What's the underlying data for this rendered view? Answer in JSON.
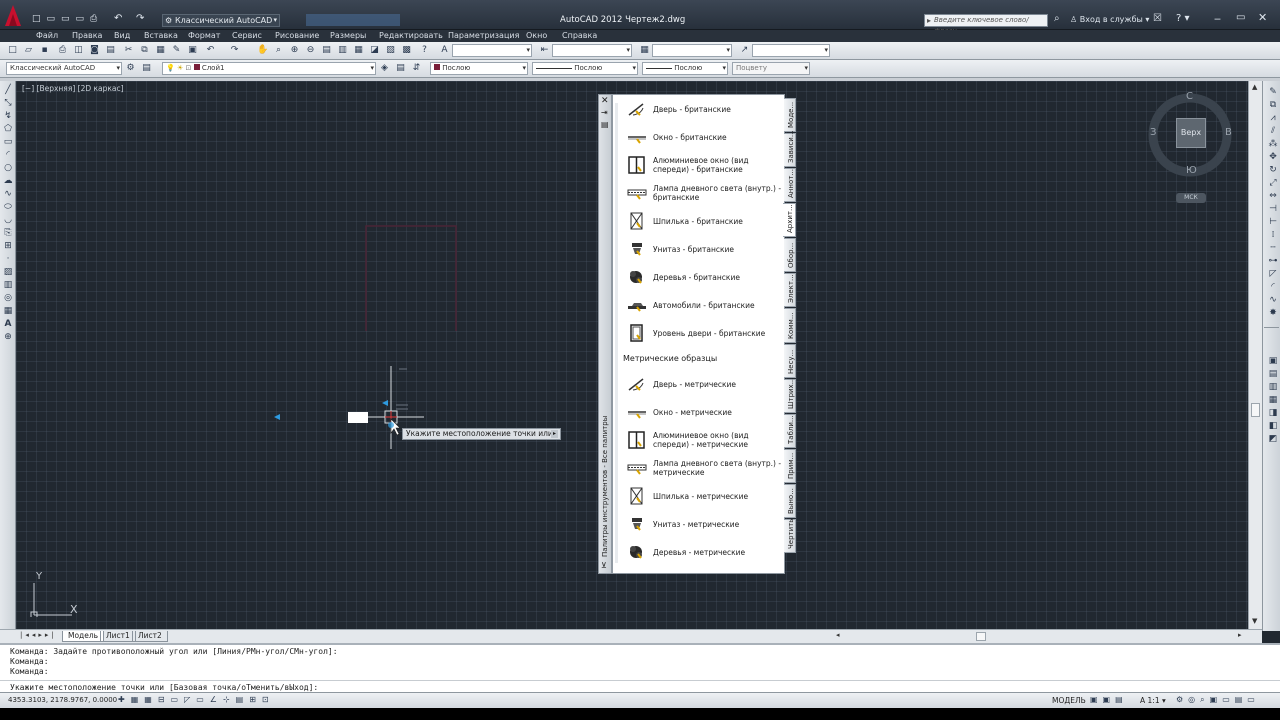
{
  "titlebar": {
    "workspace": "Классический AutoCAD",
    "title": "AutoCAD 2012   Чертеж2.dwg",
    "search_placeholder": "Введите ключевое слово/фразу",
    "signin": "Вход в службы"
  },
  "menu": [
    "Файл",
    "Правка",
    "Вид",
    "Вставка",
    "Формат",
    "Сервис",
    "Рисование",
    "Размеры",
    "Редактировать",
    "Параметризация",
    "Окно",
    "Справка"
  ],
  "toolbar2": {
    "workspace": "Классический AutoCAD",
    "layer": "Слой1",
    "color": "Послою",
    "linetype": "Послою",
    "lineweight": "Послою",
    "plotstyle": "Поцвету"
  },
  "viewport": {
    "label": "[−] [Верхняя] [2D каркас]",
    "tooltip": "Укажите местоположение точки или"
  },
  "viewcube": {
    "top": "Верх",
    "north": "С",
    "south": "Ю",
    "west": "З",
    "east": "В",
    "wcs": "МСК"
  },
  "ucs": {
    "y": "Y",
    "x": "X"
  },
  "palette": {
    "strip_title": "Палитры инструментов - Все палитры",
    "tabs": [
      "Моде...",
      "Зависи...",
      "Аннот...",
      "Архит...",
      "Обор...",
      "Элект...",
      "Комм...",
      "Несу...",
      "Штрих...",
      "Табли...",
      "Прим...",
      "Выно...",
      "Чертить"
    ],
    "items_british": [
      {
        "label": "Дверь - британские",
        "icon": "door-icon"
      },
      {
        "label": "Окно - британские",
        "icon": "window-icon"
      },
      {
        "label": "Алюминиевое окно (вид спереди) - британские",
        "icon": "aluminum-window-icon"
      },
      {
        "label": "Лампа дневного света (внутр.) - британские",
        "icon": "fluorescent-lamp-icon"
      },
      {
        "label": "Шпилька - британские",
        "icon": "stud-icon"
      },
      {
        "label": "Унитаз - британские",
        "icon": "toilet-icon"
      },
      {
        "label": "Деревья - британские",
        "icon": "tree-icon"
      },
      {
        "label": "Автомобили - британские",
        "icon": "car-icon"
      },
      {
        "label": "Уровень двери - британские",
        "icon": "door-elevation-icon"
      }
    ],
    "metric_header": "Метрические образцы",
    "items_metric": [
      {
        "label": "Дверь - метрические",
        "icon": "door-icon"
      },
      {
        "label": "Окно - метрические",
        "icon": "window-icon"
      },
      {
        "label": "Алюминиевое окно (вид спереди) - метрические",
        "icon": "aluminum-window-icon"
      },
      {
        "label": "Лампа дневного света (внутр.) - метрические",
        "icon": "fluorescent-lamp-icon"
      },
      {
        "label": "Шпилька - метрические",
        "icon": "stud-icon"
      },
      {
        "label": "Унитаз - метрические",
        "icon": "toilet-icon"
      },
      {
        "label": "Деревья - метрические",
        "icon": "tree-icon"
      }
    ]
  },
  "layout_tabs": [
    "Модель",
    "Лист1",
    "Лист2"
  ],
  "command": {
    "lines": [
      "Команда: Задайте противоположный угол или [Линия/РМн-угол/СМн-угол]:",
      "Команда:",
      "Команда:"
    ],
    "prompt": "Укажите местоположение точки или [Базовая точка/оТменить/вЫход]:"
  },
  "status": {
    "coords": "4353.3103, 2178.9767, 0.0000",
    "model": "МОДЕЛЬ",
    "scale": "1:1"
  },
  "colors": {
    "accent": "#3b7fd0",
    "canvas": "#212830",
    "layer_swatch": "#7a1f3a"
  }
}
